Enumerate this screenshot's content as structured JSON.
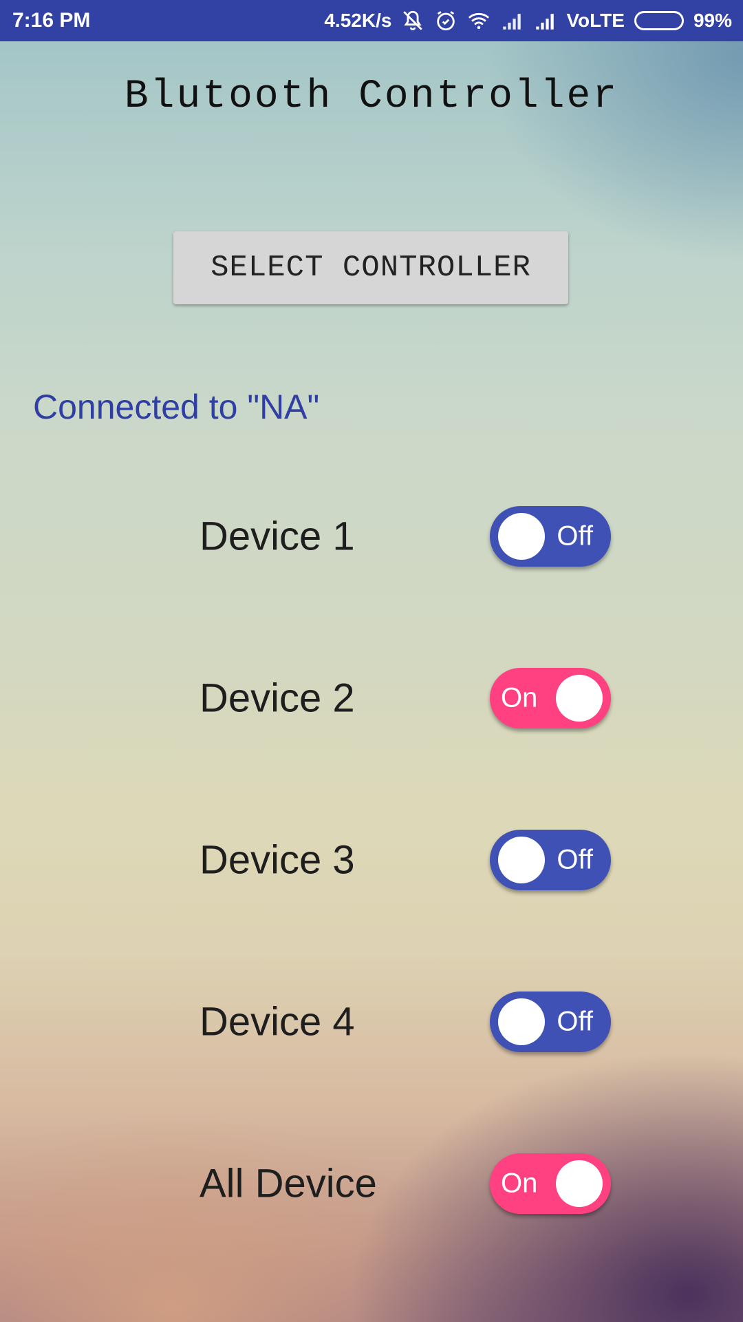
{
  "status_bar": {
    "time": "7:16 PM",
    "net_speed": "4.52K/s",
    "network_label": "VoLTE",
    "battery": "99%",
    "battery_level": 0.99,
    "icons": [
      "vibrate-off-icon",
      "alarm-icon",
      "wifi-icon",
      "signal-icon",
      "signal-icon"
    ]
  },
  "app": {
    "title": "Blutooth Controller",
    "select_button": "SELECT CONTROLLER",
    "connected_text": "Connected to \"NA\""
  },
  "devices": [
    {
      "label": "Device 1",
      "state": "Off",
      "on": false
    },
    {
      "label": "Device 2",
      "state": "On",
      "on": true
    },
    {
      "label": "Device 3",
      "state": "Off",
      "on": false
    },
    {
      "label": "Device 4",
      "state": "Off",
      "on": false
    },
    {
      "label": "All Device",
      "state": "On",
      "on": true
    }
  ],
  "colors": {
    "status_bar": "#3141a4",
    "toggle_off": "#3f51b5",
    "toggle_on": "#ff4081",
    "connected_text": "#2f3fa3"
  }
}
